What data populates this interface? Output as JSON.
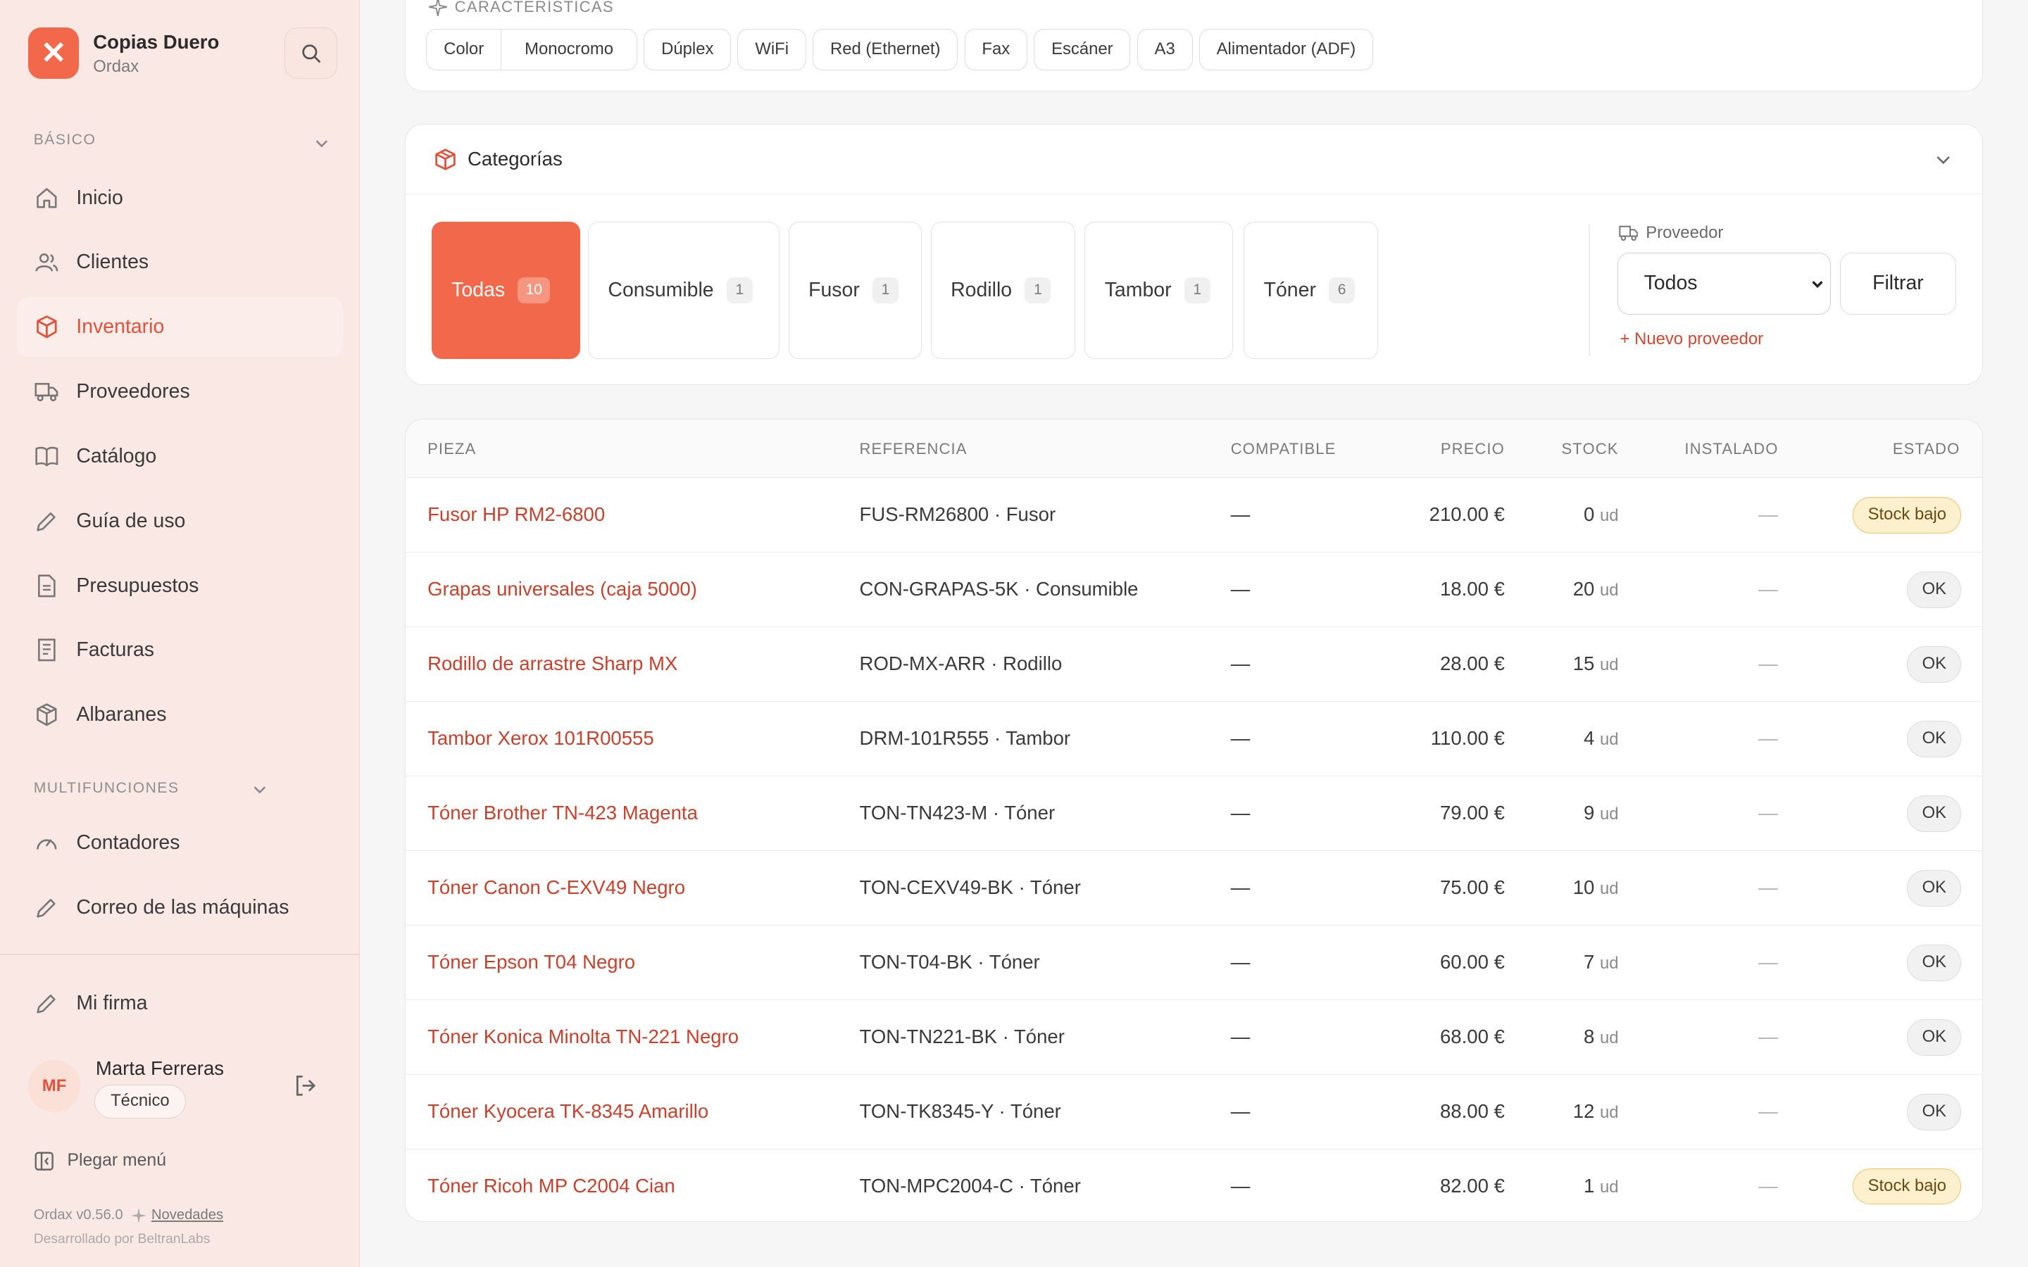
{
  "brand": {
    "name": "Copias Duero",
    "sub": "Ordax",
    "logo": "✕"
  },
  "sidebar": {
    "section_basic": "BÁSICO",
    "section_multi": "MULTIFUNCIONES",
    "items": [
      {
        "label": "Inicio",
        "icon": "home-icon"
      },
      {
        "label": "Clientes",
        "icon": "users-icon"
      },
      {
        "label": "Inventario",
        "icon": "box-icon"
      },
      {
        "label": "Proveedores",
        "icon": "truck-icon"
      },
      {
        "label": "Catálogo",
        "icon": "book-icon"
      },
      {
        "label": "Guía de uso",
        "icon": "pencil-icon"
      },
      {
        "label": "Presupuestos",
        "icon": "document-icon"
      },
      {
        "label": "Facturas",
        "icon": "receipt-icon"
      },
      {
        "label": "Albaranes",
        "icon": "package-icon"
      }
    ],
    "multi_items": [
      {
        "label": "Contadores",
        "icon": "gauge-icon"
      },
      {
        "label": "Correo de las máquinas",
        "icon": "pencil-icon"
      }
    ],
    "signature": "Mi firma",
    "user": {
      "initials": "MF",
      "name": "Marta Ferreras",
      "role": "Técnico"
    },
    "collapse": "Plegar menú",
    "version": "Ordax v0.56.0",
    "news": "Novedades",
    "credit": "Desarrollado por BeltranLabs"
  },
  "features": {
    "title": "CARACTERÍSTICAS",
    "group": [
      "Color",
      "Monocromo"
    ],
    "chips": [
      "Dúplex",
      "WiFi",
      "Red (Ethernet)",
      "Fax",
      "Escáner",
      "A3",
      "Alimentador (ADF)"
    ]
  },
  "categories": {
    "title": "Categorías",
    "items": [
      {
        "label": "Todas",
        "count": "10"
      },
      {
        "label": "Consumible",
        "count": "1"
      },
      {
        "label": "Fusor",
        "count": "1"
      },
      {
        "label": "Rodillo",
        "count": "1"
      },
      {
        "label": "Tambor",
        "count": "1"
      },
      {
        "label": "Tóner",
        "count": "6"
      }
    ],
    "provider_label": "Proveedor",
    "provider_value": "Todos",
    "filter": "Filtrar",
    "new_provider": "+ Nuevo proveedor"
  },
  "table": {
    "headers": {
      "piece": "PIEZA",
      "ref": "REFERENCIA",
      "compat": "COMPATIBLE",
      "price": "PRECIO",
      "stock": "STOCK",
      "installed": "INSTALADO",
      "status": "ESTADO"
    },
    "unit": "ud",
    "rows": [
      {
        "name": "Fusor HP RM2-6800",
        "ref": "FUS-RM26800 · Fusor",
        "compat": "—",
        "price": "210.00 €",
        "stock": "0",
        "installed": "—",
        "status": "Stock bajo"
      },
      {
        "name": "Grapas universales (caja 5000)",
        "ref": "CON-GRAPAS-5K · Consumible",
        "compat": "—",
        "price": "18.00 €",
        "stock": "20",
        "installed": "—",
        "status": "OK"
      },
      {
        "name": "Rodillo de arrastre Sharp MX",
        "ref": "ROD-MX-ARR · Rodillo",
        "compat": "—",
        "price": "28.00 €",
        "stock": "15",
        "installed": "—",
        "status": "OK"
      },
      {
        "name": "Tambor Xerox 101R00555",
        "ref": "DRM-101R555 · Tambor",
        "compat": "—",
        "price": "110.00 €",
        "stock": "4",
        "installed": "—",
        "status": "OK"
      },
      {
        "name": "Tóner Brother TN-423 Magenta",
        "ref": "TON-TN423-M · Tóner",
        "compat": "—",
        "price": "79.00 €",
        "stock": "9",
        "installed": "—",
        "status": "OK"
      },
      {
        "name": "Tóner Canon C-EXV49 Negro",
        "ref": "TON-CEXV49-BK · Tóner",
        "compat": "—",
        "price": "75.00 €",
        "stock": "10",
        "installed": "—",
        "status": "OK"
      },
      {
        "name": "Tóner Epson T04 Negro",
        "ref": "TON-T04-BK · Tóner",
        "compat": "—",
        "price": "60.00 €",
        "stock": "7",
        "installed": "—",
        "status": "OK"
      },
      {
        "name": "Tóner Konica Minolta TN-221 Negro",
        "ref": "TON-TN221-BK · Tóner",
        "compat": "—",
        "price": "68.00 €",
        "stock": "8",
        "installed": "—",
        "status": "OK"
      },
      {
        "name": "Tóner Kyocera TK-8345 Amarillo",
        "ref": "TON-TK8345-Y · Tóner",
        "compat": "—",
        "price": "88.00 €",
        "stock": "12",
        "installed": "—",
        "status": "OK"
      },
      {
        "name": "Tóner Ricoh MP C2004 Cian",
        "ref": "TON-MPC2004-C · Tóner",
        "compat": "—",
        "price": "82.00 €",
        "stock": "1",
        "installed": "—",
        "status": "Stock bajo"
      }
    ]
  },
  "colors": {
    "accent": "#f2684a",
    "accent_text": "#c8412c",
    "sidebar_bg": "#f9e8e4",
    "warn_bg": "#fdf0cf"
  }
}
